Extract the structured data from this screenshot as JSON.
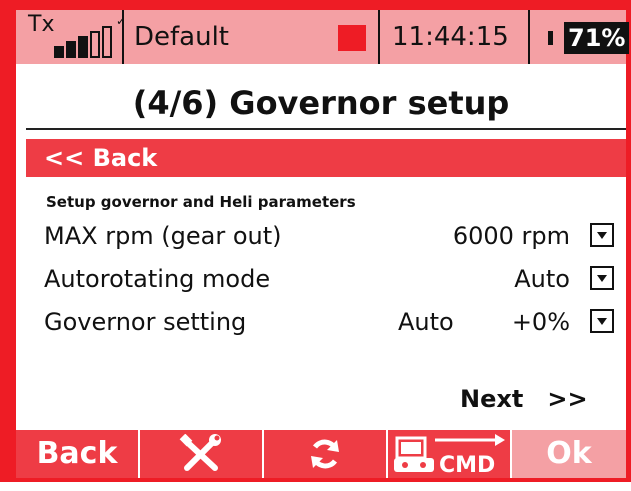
{
  "status_bar": {
    "tx_label": "Tx",
    "signal_bars_on": 3,
    "signal_bars_total": 5,
    "model_name": "Default",
    "time": "11:44:15",
    "battery_percent": "71%",
    "battery_level": 0.71
  },
  "page": {
    "title": "(4/6) Governor setup",
    "back_label": "<< Back",
    "subtitle": "Setup governor and Heli parameters",
    "rows": [
      {
        "label": "MAX rpm  (gear out)",
        "value": "6000 rpm"
      },
      {
        "label": "Autorotating mode",
        "value": "Auto"
      },
      {
        "label": "Governor setting",
        "value_mode": "Auto",
        "value": "+0%"
      }
    ],
    "next_label": "Next",
    "next_arrows": ">>"
  },
  "bottom_bar": {
    "back_label": "Back",
    "tools_icon": "wrench-screwdriver-icon",
    "refresh_icon": "refresh-icon",
    "cmd_label": "CMD",
    "ok_label": "Ok"
  },
  "colors": {
    "frame": "#ee1c25",
    "bar_light": "#f4a0a4",
    "bar_dark": "#ee3c45"
  }
}
